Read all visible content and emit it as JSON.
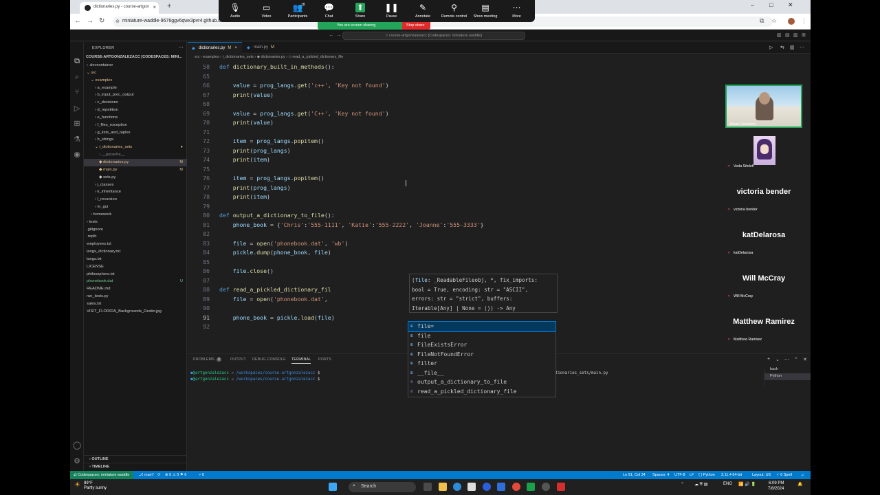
{
  "browser": {
    "tab_title": "dictionaries.py - course-artgon",
    "url": "miniature-waddle-9676ggv6qwx3pvr4.github.dev",
    "new_tab": "+",
    "close": "×",
    "win_min": "–",
    "win_max": "□",
    "win_close": "✕"
  },
  "zoom": {
    "buttons": [
      {
        "label": "Audio",
        "icon": "🎙"
      },
      {
        "label": "Video",
        "icon": "▭"
      },
      {
        "label": "Participants",
        "icon": "👥",
        "count": "18"
      },
      {
        "label": "Chat",
        "icon": "💬"
      },
      {
        "label": "Share",
        "icon": "⬆"
      },
      {
        "label": "Pause",
        "icon": "❚❚"
      },
      {
        "label": "Annotate",
        "icon": "✎"
      },
      {
        "label": "Remote control",
        "icon": "⚲"
      },
      {
        "label": "Show meeting",
        "icon": "▤"
      },
      {
        "label": "More",
        "icon": "⋯"
      }
    ],
    "sharing_text": "You are screen sharing",
    "stop_share": "Stop share"
  },
  "vscode": {
    "command_center": "course-artgonzalezacc [Codespaces: miniature waddle]",
    "explorer_title": "EXPLORER",
    "root": "COURSE-ARTGONZALEZACC [CODESPACES: MINI...",
    "tree": [
      {
        "label": "› .devcontainer",
        "indent": 4,
        "color": "#cccccc"
      },
      {
        "label": "⌄ src",
        "indent": 4,
        "color": "#e2c08d"
      },
      {
        "label": "⌄ examples",
        "indent": 10,
        "color": "#e2c08d"
      },
      {
        "label": "› a_example",
        "indent": 16,
        "color": "#cccccc"
      },
      {
        "label": "› b_input_proc_output",
        "indent": 16,
        "color": "#cccccc"
      },
      {
        "label": "› c_decisions",
        "indent": 16,
        "color": "#cccccc"
      },
      {
        "label": "› d_repetition",
        "indent": 16,
        "color": "#cccccc"
      },
      {
        "label": "› e_functions",
        "indent": 16,
        "color": "#cccccc"
      },
      {
        "label": "› f_files_exception",
        "indent": 16,
        "color": "#cccccc"
      },
      {
        "label": "› g_lists_and_tuples",
        "indent": 16,
        "color": "#cccccc"
      },
      {
        "label": "› h_strings",
        "indent": 16,
        "color": "#cccccc"
      },
      {
        "label": "⌄ i_dictionaries_sets",
        "indent": 16,
        "color": "#e2c08d",
        "mark": "●"
      },
      {
        "label": "› __pycache__",
        "indent": 22,
        "color": "#8c8c8c"
      },
      {
        "label": "◆ dictionaries.py",
        "indent": 22,
        "color": "#e2c08d",
        "mark": "M",
        "selected": true
      },
      {
        "label": "◆ main.py",
        "indent": 22,
        "color": "#e2c08d",
        "mark": "M"
      },
      {
        "label": "◆ sets.py",
        "indent": 22,
        "color": "#cccccc"
      },
      {
        "label": "› j_classes",
        "indent": 16,
        "color": "#cccccc"
      },
      {
        "label": "› k_inheritance",
        "indent": 16,
        "color": "#cccccc"
      },
      {
        "label": "› l_recursion",
        "indent": 16,
        "color": "#cccccc"
      },
      {
        "label": "› m_gui",
        "indent": 16,
        "color": "#cccccc"
      },
      {
        "label": "› homework",
        "indent": 10,
        "color": "#cccccc"
      },
      {
        "label": "› tests",
        "indent": 4,
        "color": "#cccccc"
      },
      {
        "label": "  .gitignore",
        "indent": 4,
        "color": "#cccccc"
      },
      {
        "label": "  .replit",
        "indent": 4,
        "color": "#cccccc"
      },
      {
        "label": "  employees.txt",
        "indent": 4,
        "color": "#cccccc"
      },
      {
        "label": "  langs_dictionary.txt",
        "indent": 4,
        "color": "#cccccc"
      },
      {
        "label": "  langs.txt",
        "indent": 4,
        "color": "#cccccc"
      },
      {
        "label": "  LICENSE",
        "indent": 4,
        "color": "#cccccc"
      },
      {
        "label": "  philosophers.txt",
        "indent": 4,
        "color": "#cccccc"
      },
      {
        "label": "  phonebook.dat",
        "indent": 4,
        "color": "#73c991",
        "mark": "U"
      },
      {
        "label": "  README.md",
        "indent": 4,
        "color": "#cccccc"
      },
      {
        "label": "  run_tests.py",
        "indent": 4,
        "color": "#cccccc"
      },
      {
        "label": "  sales.txt",
        "indent": 4,
        "color": "#cccccc"
      },
      {
        "label": "  VISIT_FLORIDA_Backgrounds_Destin.jpg",
        "indent": 4,
        "color": "#cccccc"
      }
    ],
    "outline": "› OUTLINE",
    "timeline": "› TIMELINE",
    "tabs": [
      {
        "label": "dictionaries.py",
        "mark": "M",
        "active": true
      },
      {
        "label": "main.py",
        "mark": "M",
        "active": false
      }
    ],
    "breadcrumbs": "src › examples › i_dictionaries_sets › ◆ dictionaries.py › ◇ read_a_pickled_dictionary_file",
    "code": [
      {
        "n": "58",
        "html": "<span class='kw'>def</span> <span class='fn'>dictionary_built_in_methods</span>():"
      },
      {
        "n": "65",
        "html": ""
      },
      {
        "n": "66",
        "html": "    <span class='vr'>value</span> = <span class='vr'>prog_langs</span>.<span class='fn'>get</span>(<span class='st'>'c++'</span>, <span class='st'>'Key not found'</span>)"
      },
      {
        "n": "67",
        "html": "    <span class='fn'>print</span>(<span class='vr'>value</span>)"
      },
      {
        "n": "68",
        "html": ""
      },
      {
        "n": "69",
        "html": "    <span class='vr'>value</span> = <span class='vr'>prog_langs</span>.<span class='fn'>get</span>(<span class='st'>'C++'</span>, <span class='st'>'Key not found'</span>)"
      },
      {
        "n": "70",
        "html": "    <span class='fn'>print</span>(<span class='vr'>value</span>)"
      },
      {
        "n": "71",
        "html": ""
      },
      {
        "n": "72",
        "html": "    <span class='vr'>item</span> = <span class='vr'>prog_langs</span>.<span class='fn'>popitem</span>()"
      },
      {
        "n": "73",
        "html": "    <span class='fn'>print</span>(<span class='vr'>prog_langs</span>)"
      },
      {
        "n": "74",
        "html": "    <span class='fn'>print</span>(<span class='vr'>item</span>)"
      },
      {
        "n": "75",
        "html": ""
      },
      {
        "n": "76",
        "html": "    <span class='vr'>item</span> = <span class='vr'>prog_langs</span>.<span class='fn'>popitem</span>()"
      },
      {
        "n": "77",
        "html": "    <span class='fn'>print</span>(<span class='vr'>prog_langs</span>)"
      },
      {
        "n": "78",
        "html": "    <span class='fn'>print</span>(<span class='vr'>item</span>)"
      },
      {
        "n": "79",
        "html": ""
      },
      {
        "n": "80",
        "html": "<span class='kw'>def</span> <span class='fn'>output_a_dictionary_to_file</span>():"
      },
      {
        "n": "81",
        "html": "    <span class='vr'>phone_book</span> = {<span class='st'>'Chris'</span>:<span class='st'>'555-1111'</span>, <span class='st'>'Katie'</span>:<span class='st'>'555-2222'</span>, <span class='st'>'Joanne'</span>:<span class='st'>'555-3333'</span>}"
      },
      {
        "n": "82",
        "html": ""
      },
      {
        "n": "83",
        "html": "    <span class='vr'>file</span> = <span class='fn'>open</span>(<span class='st'>'phonebook.dat'</span>, <span class='st'>'wb'</span>)"
      },
      {
        "n": "84",
        "html": "    <span class='vr'>pickle</span>.<span class='fn'>dump</span>(<span class='vr'>phone_book</span>, <span class='vr'>file</span>)"
      },
      {
        "n": "85",
        "html": ""
      },
      {
        "n": "86",
        "html": "    <span class='vr'>file</span>.<span class='fn'>close</span>()"
      },
      {
        "n": "87",
        "html": ""
      },
      {
        "n": "88",
        "html": "<span class='kw'>def</span> <span class='fn'>read_a_pickled_dictionary_fil</span>"
      },
      {
        "n": "89",
        "html": "    <span class='vr'>file</span> = <span class='fn'>open</span>(<span class='st'>'phonebook.dat'</span>,"
      },
      {
        "n": "90",
        "html": ""
      },
      {
        "n": "91",
        "html": "    <span class='vr'>phone_book</span> = <span class='vr'>pickle</span>.<span class='fn'>load</span>(<span class='vr'>file</span>)"
      },
      {
        "n": "92",
        "html": ""
      }
    ],
    "hover_lines": [
      "(<span class='p'>file</span>: _ReadableFileobj, *, fix_imports:",
      "bool = True, encoding: str = \"ASCII\",",
      "errors: str = \"strict\", buffers:",
      "Iterable[Any] | None = ()) -> Any"
    ],
    "suggestions": [
      {
        "label": "file=",
        "icon": "⊞",
        "selected": true
      },
      {
        "label": "file",
        "icon": "⊞"
      },
      {
        "label": "FileExistsError",
        "icon": "⊞"
      },
      {
        "label": "FileNotFoundError",
        "icon": "⊞"
      },
      {
        "label": "filter",
        "icon": "⊞"
      },
      {
        "label": "__file__",
        "icon": "⊞"
      },
      {
        "label": "output_a_dictionary_to_file",
        "icon": "⊙"
      },
      {
        "label": "read_a_pickled_dictionary_file",
        "icon": "⊙"
      }
    ],
    "panel_tabs": [
      {
        "label": "PROBLEMS",
        "badge": "2"
      },
      {
        "label": "OUTPUT"
      },
      {
        "label": "DEBUG CONSOLE"
      },
      {
        "label": "TERMINAL",
        "active": true
      },
      {
        "label": "PORTS"
      }
    ],
    "terminal_lines": [
      {
        "user": "@artgonzalezacc",
        "path": "/workspaces/course-artgonzalezacc",
        "rest": " $ ",
        "tail": "gonzalezacc/src/examples/i_dictionaries_sets/main.py"
      },
      {
        "user": "@artgonzalezacc",
        "path": "/workspaces/course-artgonzalezacc",
        "rest": " $ ",
        "tail": ""
      }
    ],
    "terminal_list": [
      {
        "label": "bash"
      },
      {
        "label": "Python",
        "selected": true
      }
    ],
    "status": {
      "remote": "⇄ Codespaces: miniature waddle",
      "branch": "⎇ main*",
      "sync": "⟳",
      "problems": "⊗ 0 ⚠ 0 ⚑ 6",
      "ports": "⑂ 0",
      "cursor": "Ln 91, Col 34",
      "spaces": "Spaces: 4",
      "encoding": "UTF-8",
      "eol": "LF",
      "language": "{ } Python",
      "interpreter": "3.11.4 64-bit",
      "layout": "Layout: US",
      "spell": "✓ 6 Spell"
    }
  },
  "participants": {
    "main": "Arturo Gonzalez",
    "list": [
      {
        "name": "Veda Sitoleh",
        "big": ""
      },
      {
        "name": "victoria bender",
        "big": "victoria bender"
      },
      {
        "name": "katDelarosa",
        "big": "katDelarosa"
      },
      {
        "name": "Will McCray",
        "big": "Will McCray"
      },
      {
        "name": "Matthew Ramirez",
        "big": "Matthew Ramirez"
      }
    ]
  },
  "taskbar": {
    "temp": "89°F",
    "weather": "Partly sunny",
    "search": "Search",
    "lang": "ENG",
    "time": "6:09 PM",
    "date": "7/8/2024"
  },
  "colors": {
    "accent": "#007acc",
    "remote": "#16825d",
    "share_green": "#23a55a",
    "share_red": "#e02b2b"
  }
}
